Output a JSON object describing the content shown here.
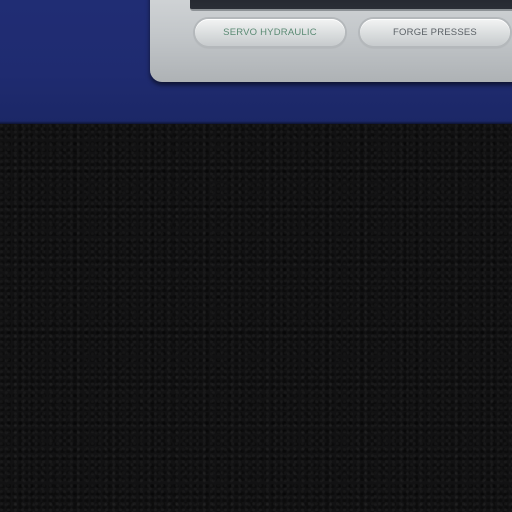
{
  "nav": {
    "tabs": [
      {
        "label": "SERVO HYDRAULIC",
        "active": true
      },
      {
        "label": "FORGE PRESSES",
        "active": false
      }
    ]
  },
  "colors": {
    "header_band": "#1f2b70",
    "panel_silver": "#c2c6c9",
    "background_leather": "#121213",
    "active_tab_text": "#5a8a73",
    "inactive_tab_text": "#5b6166"
  }
}
